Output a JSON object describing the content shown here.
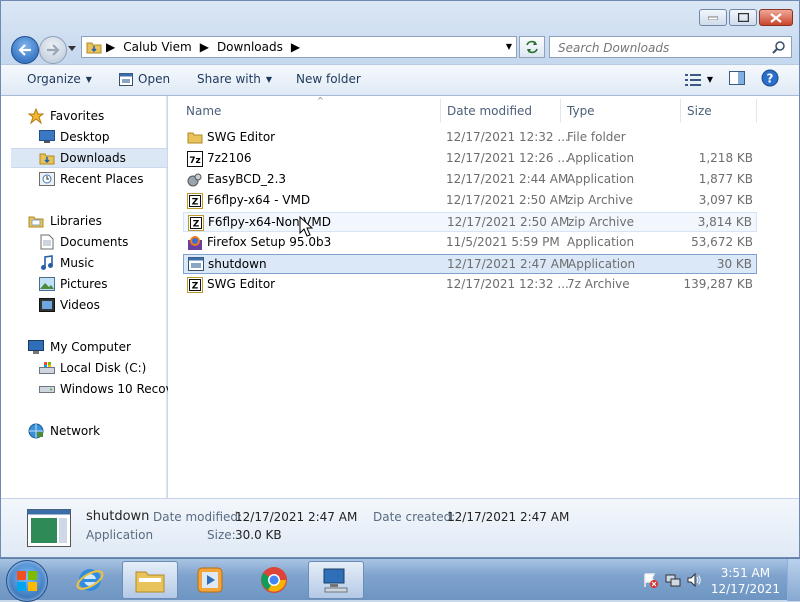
{
  "breadcrumb": [
    "Calub Viem",
    "Downloads"
  ],
  "search": {
    "placeholder": "Search Downloads"
  },
  "toolbar": {
    "organize": "Organize",
    "open": "Open",
    "share_with": "Share with",
    "new_folder": "New folder"
  },
  "nav": {
    "favorites": "Favorites",
    "desktop": "Desktop",
    "downloads": "Downloads",
    "recent_places": "Recent Places",
    "libraries": "Libraries",
    "documents": "Documents",
    "music": "Music",
    "pictures": "Pictures",
    "videos": "Videos",
    "my_computer": "My Computer",
    "local_disk": "Local Disk (C:)",
    "recovery": "Windows 10 Recove",
    "network": "Network"
  },
  "columns": {
    "name": "Name",
    "date": "Date modified",
    "type": "Type",
    "size": "Size"
  },
  "files": [
    {
      "name": "SWG Editor",
      "date": "12/17/2021 12:32 ...",
      "type": "File folder",
      "size": "",
      "icon": "folder-icon"
    },
    {
      "name": "7z2106",
      "date": "12/17/2021 12:26 ...",
      "type": "Application",
      "size": "1,218 KB",
      "icon": "7zip-app-icon"
    },
    {
      "name": "EasyBCD_2.3",
      "date": "12/17/2021 2:44 AM",
      "type": "Application",
      "size": "1,877 KB",
      "icon": "installer-icon"
    },
    {
      "name": "F6flpy-x64 - VMD",
      "date": "12/17/2021 2:50 AM",
      "type": "zip Archive",
      "size": "3,097 KB",
      "icon": "7zip-archive-icon"
    },
    {
      "name": "F6flpy-x64-Non-VMD",
      "date": "12/17/2021 2:50 AM",
      "type": "zip Archive",
      "size": "3,814 KB",
      "icon": "7zip-archive-icon"
    },
    {
      "name": "Firefox Setup 95.0b3",
      "date": "11/5/2021 5:59 PM",
      "type": "Application",
      "size": "53,672 KB",
      "icon": "firefox-setup-icon"
    },
    {
      "name": "shutdown",
      "date": "12/17/2021 2:47 AM",
      "type": "Application",
      "size": "30 KB",
      "icon": "application-icon"
    },
    {
      "name": "SWG Editor",
      "date": "12/17/2021 12:32 ...",
      "type": "7z Archive",
      "size": "139,287 KB",
      "icon": "7zip-archive-icon"
    }
  ],
  "details": {
    "name": "shutdown",
    "kind": "Application",
    "date_modified_label": "Date modified:",
    "date_modified": "12/17/2021 2:47 AM",
    "date_created_label": "Date created:",
    "date_created": "12/17/2021 2:47 AM",
    "size_label": "Size:",
    "size": "30.0 KB"
  },
  "clock": {
    "time": "3:51 AM",
    "date": "12/17/2021"
  }
}
